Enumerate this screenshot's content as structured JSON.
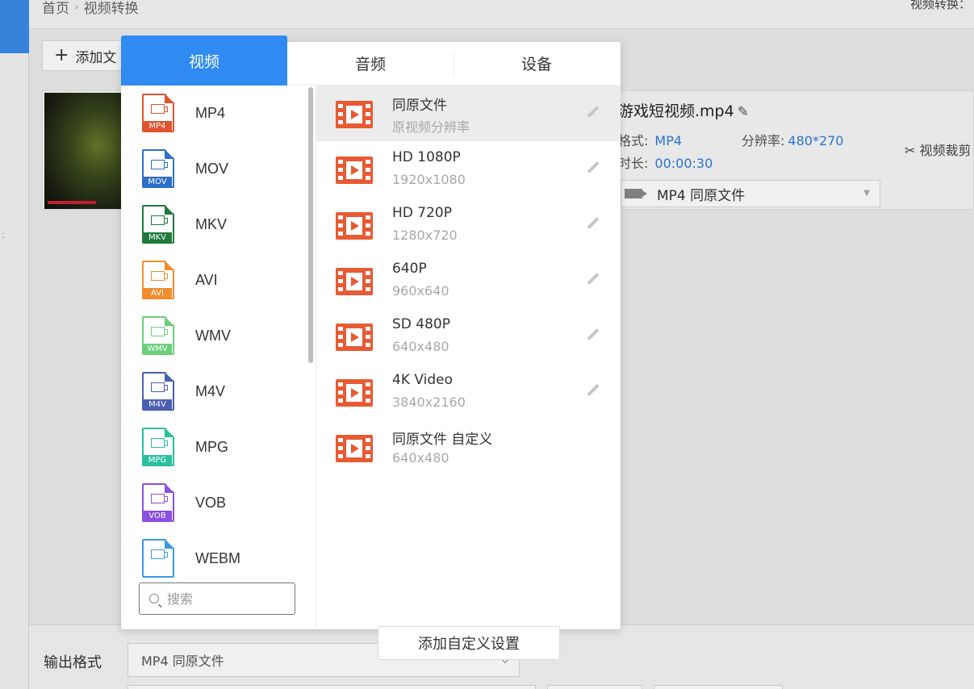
{
  "header": {
    "breadcrumb_home": "首页",
    "breadcrumb_sep": "›",
    "breadcrumb_current": "视频转换",
    "right_text": "视频转换："
  },
  "toolbar": {
    "add_file_label": "添加文"
  },
  "file": {
    "name": "游戏短视频.mp4",
    "format_label": "格式:",
    "format_value": "MP4",
    "resolution_label": "分辨率:",
    "resolution_value": "480*270",
    "duration_label": "时长:",
    "duration_value": "00:00:30",
    "crop_label": "视频裁剪",
    "select_value": "MP4  同原文件"
  },
  "popup": {
    "tabs": [
      {
        "label": "视频",
        "active": true
      },
      {
        "label": "音频",
        "active": false
      },
      {
        "label": "设备",
        "active": false
      }
    ],
    "formats": [
      {
        "label": "MP4",
        "tag": "MP4",
        "color": "#e0532f"
      },
      {
        "label": "MOV",
        "tag": "MOV",
        "color": "#2d6ec9"
      },
      {
        "label": "MKV",
        "tag": "MKV",
        "color": "#1f7a3c"
      },
      {
        "label": "AVI",
        "tag": "AVI",
        "color": "#f08c2e"
      },
      {
        "label": "WMV",
        "tag": "WMV",
        "color": "#6ccf7a"
      },
      {
        "label": "M4V",
        "tag": "M4V",
        "color": "#4a5fb0"
      },
      {
        "label": "MPG",
        "tag": "MPG",
        "color": "#2bbf9c"
      },
      {
        "label": "VOB",
        "tag": "VOB",
        "color": "#8a4fe0"
      },
      {
        "label": "WEBM",
        "tag": "",
        "color": "#3a9ae6"
      }
    ],
    "search_placeholder": "搜索",
    "presets": [
      {
        "title": "同原文件",
        "sub": "原视频分辨率",
        "editable": true,
        "selected": true
      },
      {
        "title": "HD 1080P",
        "sub": "1920x1080",
        "editable": true
      },
      {
        "title": "HD 720P",
        "sub": "1280x720",
        "editable": true
      },
      {
        "title": "640P",
        "sub": "960x640",
        "editable": true
      },
      {
        "title": "SD 480P",
        "sub": "640x480",
        "editable": true
      },
      {
        "title": "4K Video",
        "sub": "3840x2160",
        "editable": true
      },
      {
        "title": "同原文件 自定义",
        "sub": "640x480",
        "editable": false
      }
    ],
    "add_custom_label": "添加自定义设置"
  },
  "bottom": {
    "output_label": "输出格式",
    "output_value": "MP4  同原文件"
  },
  "colors": {
    "accent": "#2f8af2",
    "film_icon": "#e85a33",
    "link": "#2d7be0"
  }
}
